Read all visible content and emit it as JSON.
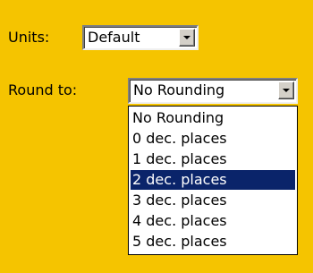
{
  "units": {
    "label": "Units:",
    "value": "Default"
  },
  "round": {
    "label": "Round to:",
    "value": "No Rounding",
    "options": [
      "No Rounding",
      "0 dec. places",
      "1 dec. places",
      "2 dec. places",
      "3 dec. places",
      "4 dec. places",
      "5 dec. places"
    ],
    "highlighted_option": "2 dec. places"
  },
  "colors": {
    "background": "#f5c400",
    "highlight": "#0a246a"
  }
}
